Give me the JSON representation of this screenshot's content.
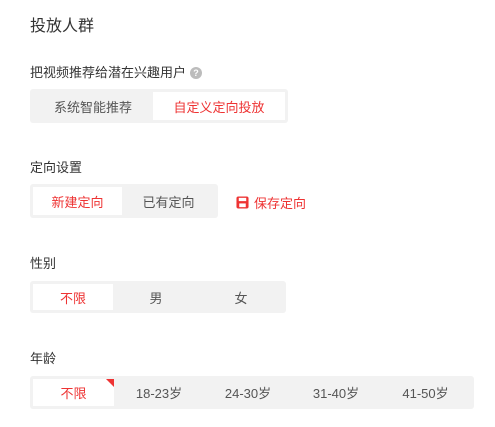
{
  "section_title": "投放人群",
  "recommend": {
    "label": "把视频推荐给潜在兴趣用户",
    "help_icon": "?",
    "options": [
      {
        "label": "系统智能推荐",
        "active": false
      },
      {
        "label": "自定义定向投放",
        "active": true
      }
    ]
  },
  "targeting": {
    "label": "定向设置",
    "options": [
      {
        "label": "新建定向",
        "active": true
      },
      {
        "label": "已有定向",
        "active": false
      }
    ],
    "save_label": "保存定向"
  },
  "gender": {
    "label": "性别",
    "options": [
      {
        "label": "不限",
        "active": true
      },
      {
        "label": "男",
        "active": false
      },
      {
        "label": "女",
        "active": false
      }
    ]
  },
  "age": {
    "label": "年龄",
    "options": [
      {
        "label": "不限",
        "active": true
      },
      {
        "label": "18-23岁",
        "active": false
      },
      {
        "label": "24-30岁",
        "active": false
      },
      {
        "label": "31-40岁",
        "active": false
      },
      {
        "label": "41-50岁",
        "active": false
      }
    ]
  },
  "colors": {
    "accent": "#e33333",
    "segment_bg": "#f2f2f2"
  }
}
